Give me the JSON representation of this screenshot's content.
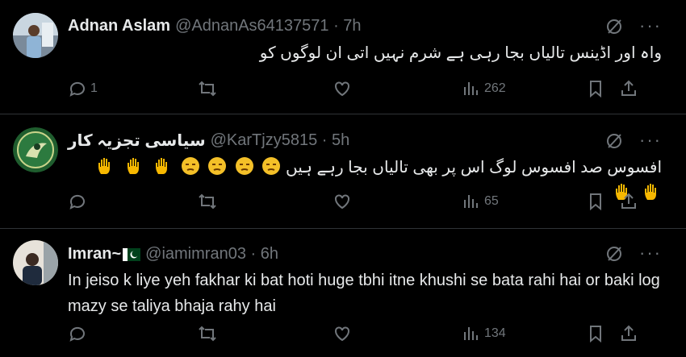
{
  "tweets": [
    {
      "name": "Adnan Aslam",
      "handle": "@AdnanAs64137571 · 7h",
      "text": "واہ اور اڈینس تالیاں بجا رہی ہے شرم نہیں اتی ان لوگوں کو",
      "replies": "1",
      "reposts": "",
      "likes": "",
      "views": "262"
    },
    {
      "name": "سیاسی تجزیہ کار",
      "handle": "@KarTjzy5815 · 5h",
      "text": "افسوس صد افسوس لوگ اس پر بھی تالیاں بجا رہے ہیں",
      "replies": "",
      "reposts": "",
      "likes": "",
      "views": "65"
    },
    {
      "name": "Imran~",
      "handle": "@iamimran03 · 6h",
      "text": "In jeiso k liye yeh fakhar ki bat hoti huge tbhi itne khushi se bata rahi hai or baki log mazy se taliya bhaja rahy hai",
      "replies": "",
      "reposts": "",
      "likes": "",
      "views": "134"
    }
  ],
  "icons": [
    "grok-icon",
    "more-icon",
    "reply-icon",
    "repost-icon",
    "like-icon",
    "views-icon",
    "bookmark-icon",
    "share-icon"
  ]
}
